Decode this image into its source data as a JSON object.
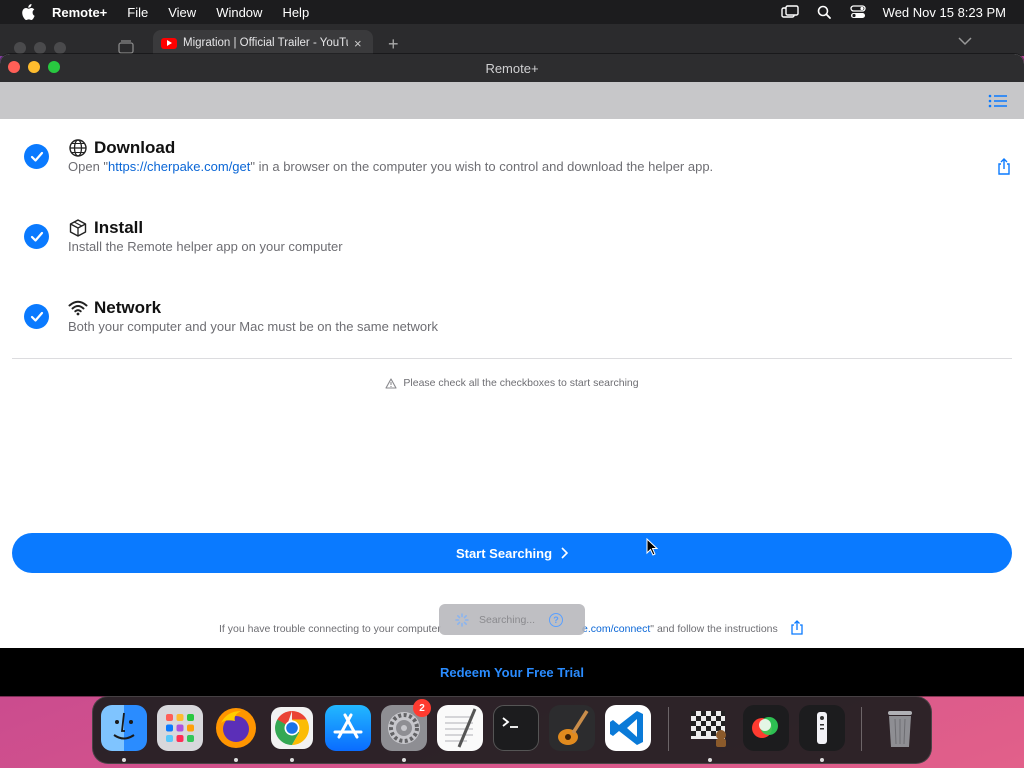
{
  "menubar": {
    "app_name": "Remote+",
    "items": [
      "File",
      "View",
      "Window",
      "Help"
    ],
    "clock": "Wed Nov 15  8:23 PM"
  },
  "browser": {
    "tab_title": "Migration | Official Trailer - YouTube",
    "tab_close": "×",
    "new_tab": "+"
  },
  "window": {
    "title": "Remote+"
  },
  "steps": [
    {
      "title": "Download",
      "desc_prefix": "Open \"",
      "desc_link": "https://cherpake.com/get",
      "desc_suffix": "\" in a browser on the computer you wish to control and download the helper app."
    },
    {
      "title": "Install",
      "desc": "Install the Remote helper app on your computer"
    },
    {
      "title": "Network",
      "desc": "Both your computer and your Mac must be on the same network"
    }
  ],
  "notice": "Please check all the checkboxes to start searching",
  "start_button": "Start Searching",
  "trouble": {
    "prefix": "If you have trouble connecting to your computer",
    "link": "e.com/connect",
    "suffix": "\" and follow the instructions"
  },
  "searching_toast": {
    "label": "Searching...",
    "help": "?"
  },
  "redeem": "Redeem Your Free Trial",
  "dock": {
    "settings_badge": "2"
  },
  "colors": {
    "accent": "#0a7aff",
    "link": "#0a66d6",
    "redeem": "#2a8cff"
  }
}
